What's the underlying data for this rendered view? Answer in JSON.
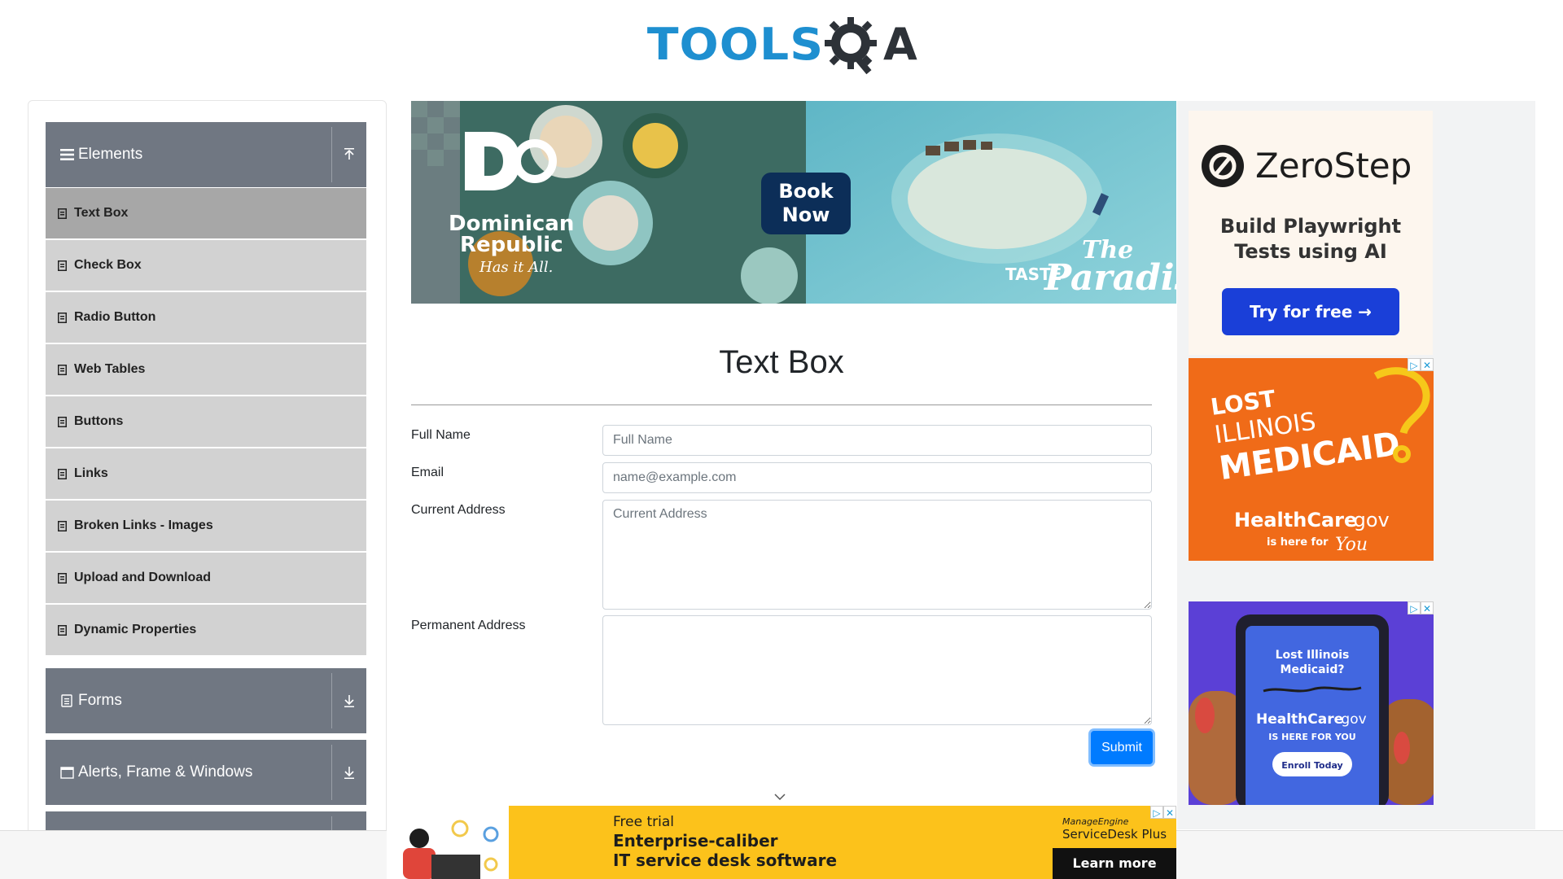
{
  "header": {
    "logo_text_left": "TOOLS",
    "logo_text_right": "A"
  },
  "sidebar": {
    "groups": [
      {
        "title": "Elements",
        "expanded": true
      },
      {
        "title": "Forms",
        "expanded": false
      },
      {
        "title": "Alerts, Frame & Windows",
        "expanded": false
      }
    ],
    "items": [
      {
        "label": "Text Box",
        "active": true
      },
      {
        "label": "Check Box"
      },
      {
        "label": "Radio Button"
      },
      {
        "label": "Web Tables"
      },
      {
        "label": "Buttons"
      },
      {
        "label": "Links"
      },
      {
        "label": "Broken Links - Images"
      },
      {
        "label": "Upload and Download"
      },
      {
        "label": "Dynamic Properties"
      }
    ]
  },
  "top_ad": {
    "brand_line1": "Dominican",
    "brand_line2": "Republic",
    "tagline": "Has it All.",
    "cta": "Book Now",
    "cta_line1": "Book",
    "cta_line2": "Now",
    "slogan_small": "TASTE",
    "slogan_big": "Paradise",
    "slogan_the": "The"
  },
  "main": {
    "title": "Text Box",
    "form": {
      "full_name_label": "Full Name",
      "full_name_placeholder": "Full Name",
      "email_label": "Email",
      "email_placeholder": "name@example.com",
      "current_address_label": "Current Address",
      "current_address_placeholder": "Current Address",
      "permanent_address_label": "Permanent Address",
      "permanent_address_placeholder": "",
      "submit_label": "Submit"
    }
  },
  "right_ads": {
    "zerostep": {
      "brand": "ZeroStep",
      "headline_line1": "Build Playwright",
      "headline_line2": "Tests using AI",
      "cta": "Try for free →"
    },
    "medicaid1": {
      "line1": "LOST",
      "line2": "ILLINOIS",
      "line3": "MEDICAID",
      "brand": "HealthCare",
      "brand_suffix": ".gov",
      "tagline": "is here for",
      "tagline_script": "You"
    },
    "medicaid2": {
      "phone_line1": "Lost Illinois",
      "phone_line2": "Medicaid?",
      "brand": "HealthCare",
      "brand_suffix": ".gov",
      "tagline": "IS HERE FOR YOU",
      "cta": "Enroll Today"
    },
    "colors": {
      "accent_blue": "#1a3fd8",
      "orange": "#f06b18",
      "purple": "#5b40d6"
    }
  },
  "bottom_ad": {
    "kicker": "Free trial",
    "headline_line1": "Enterprise-caliber",
    "headline_line2": "IT service desk software",
    "vendor": "ManageEngine",
    "product": "ServiceDesk Plus",
    "cta": "Learn more"
  }
}
